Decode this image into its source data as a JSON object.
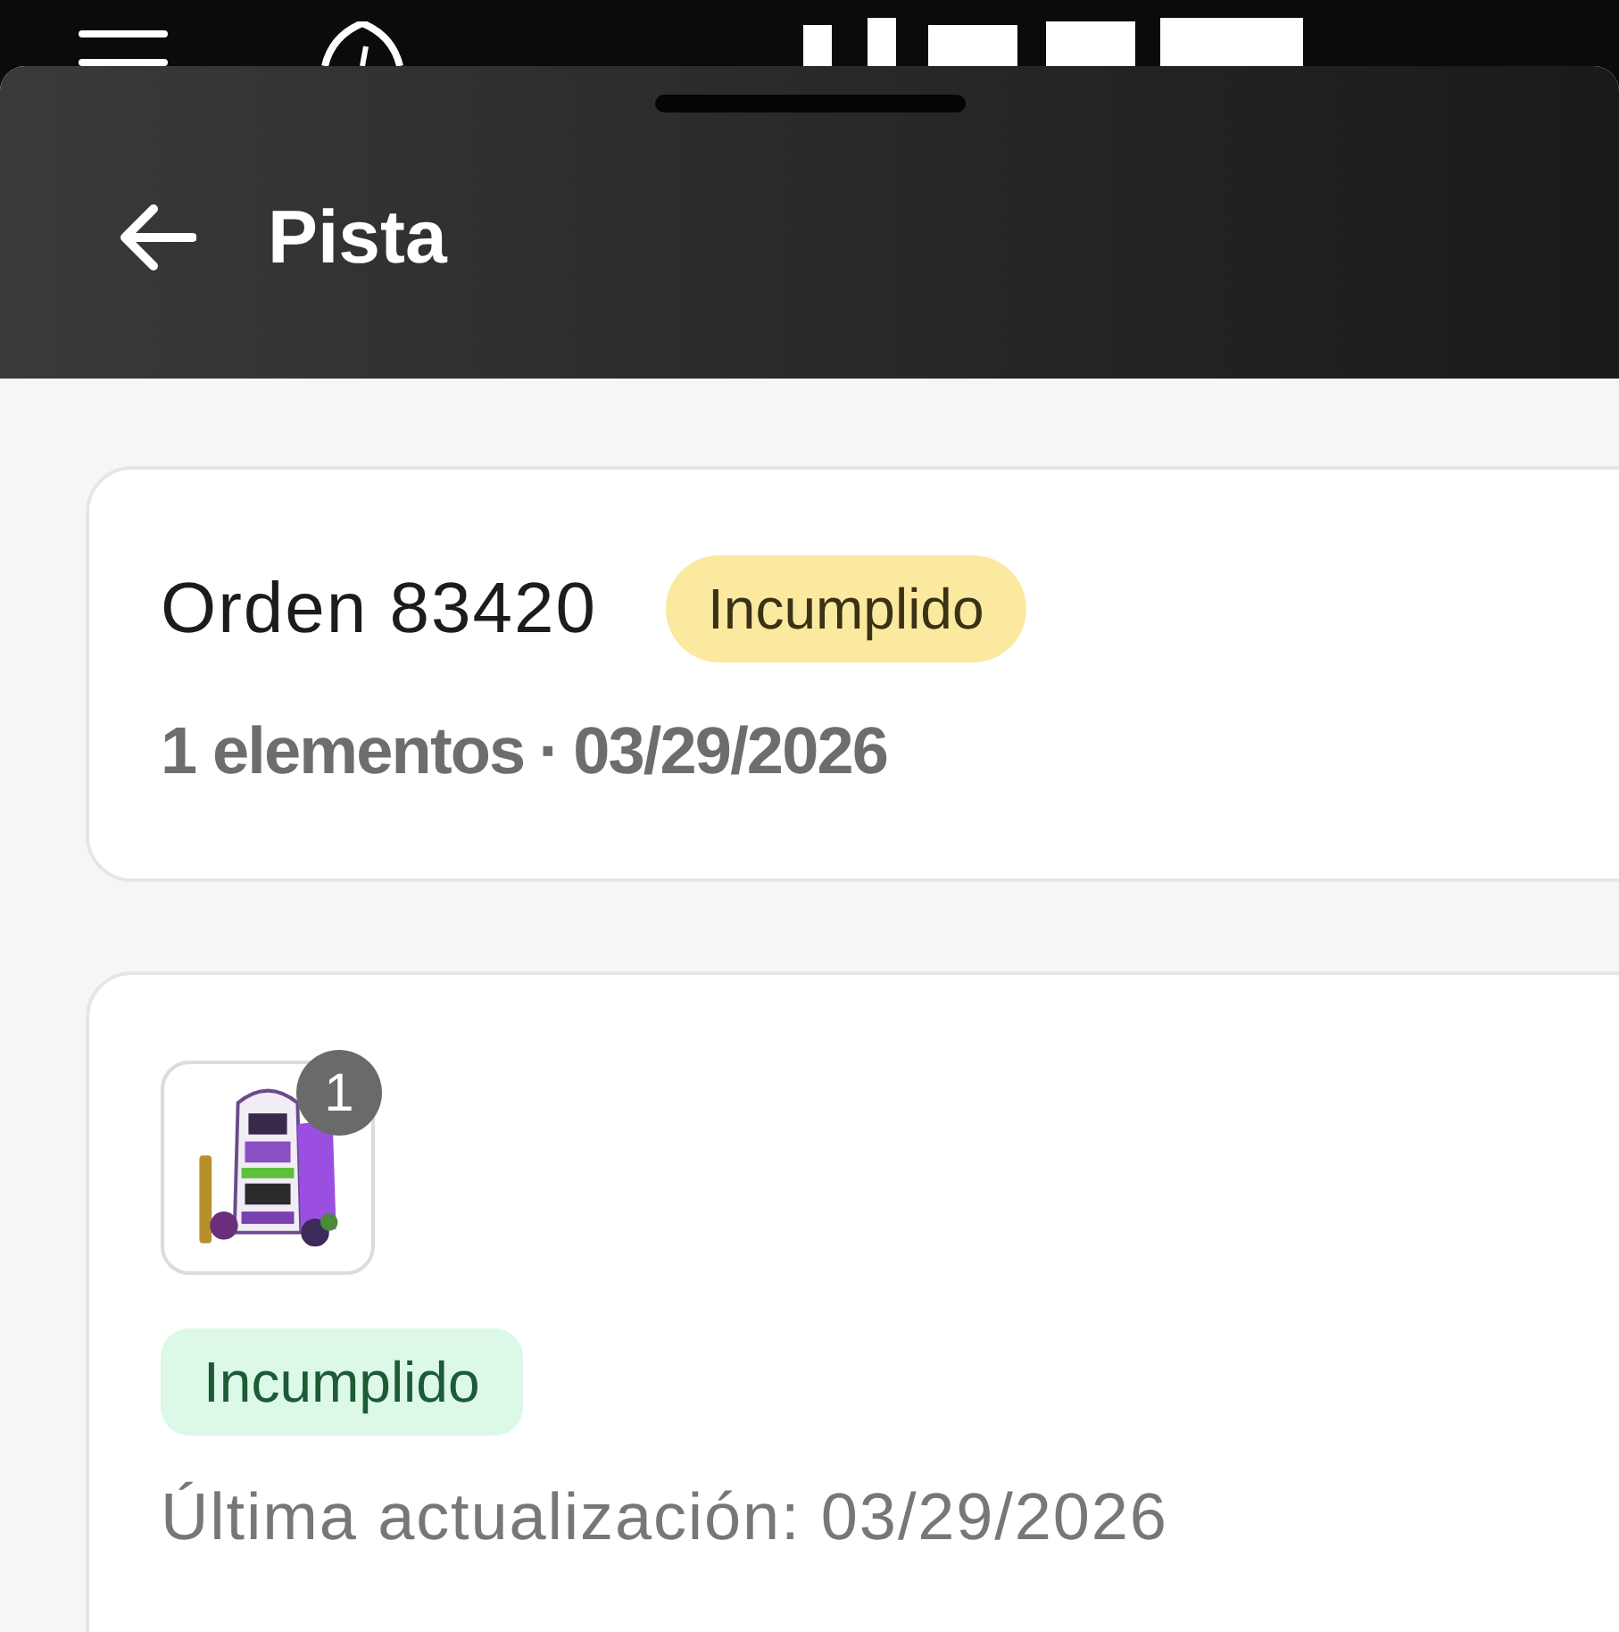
{
  "header": {
    "title": "Pista"
  },
  "order": {
    "title": "Orden 83420",
    "status": {
      "label": "Incumplido",
      "kind": "warning"
    },
    "items_count": "1 elementos",
    "separator": "·",
    "date": "03/29/2026"
  },
  "shipment": {
    "item": {
      "kind": "picture",
      "quantity": "1"
    },
    "status": {
      "label": "Incumplido",
      "kind": "success"
    },
    "updated": "Última actualización: 03/29/2026"
  }
}
